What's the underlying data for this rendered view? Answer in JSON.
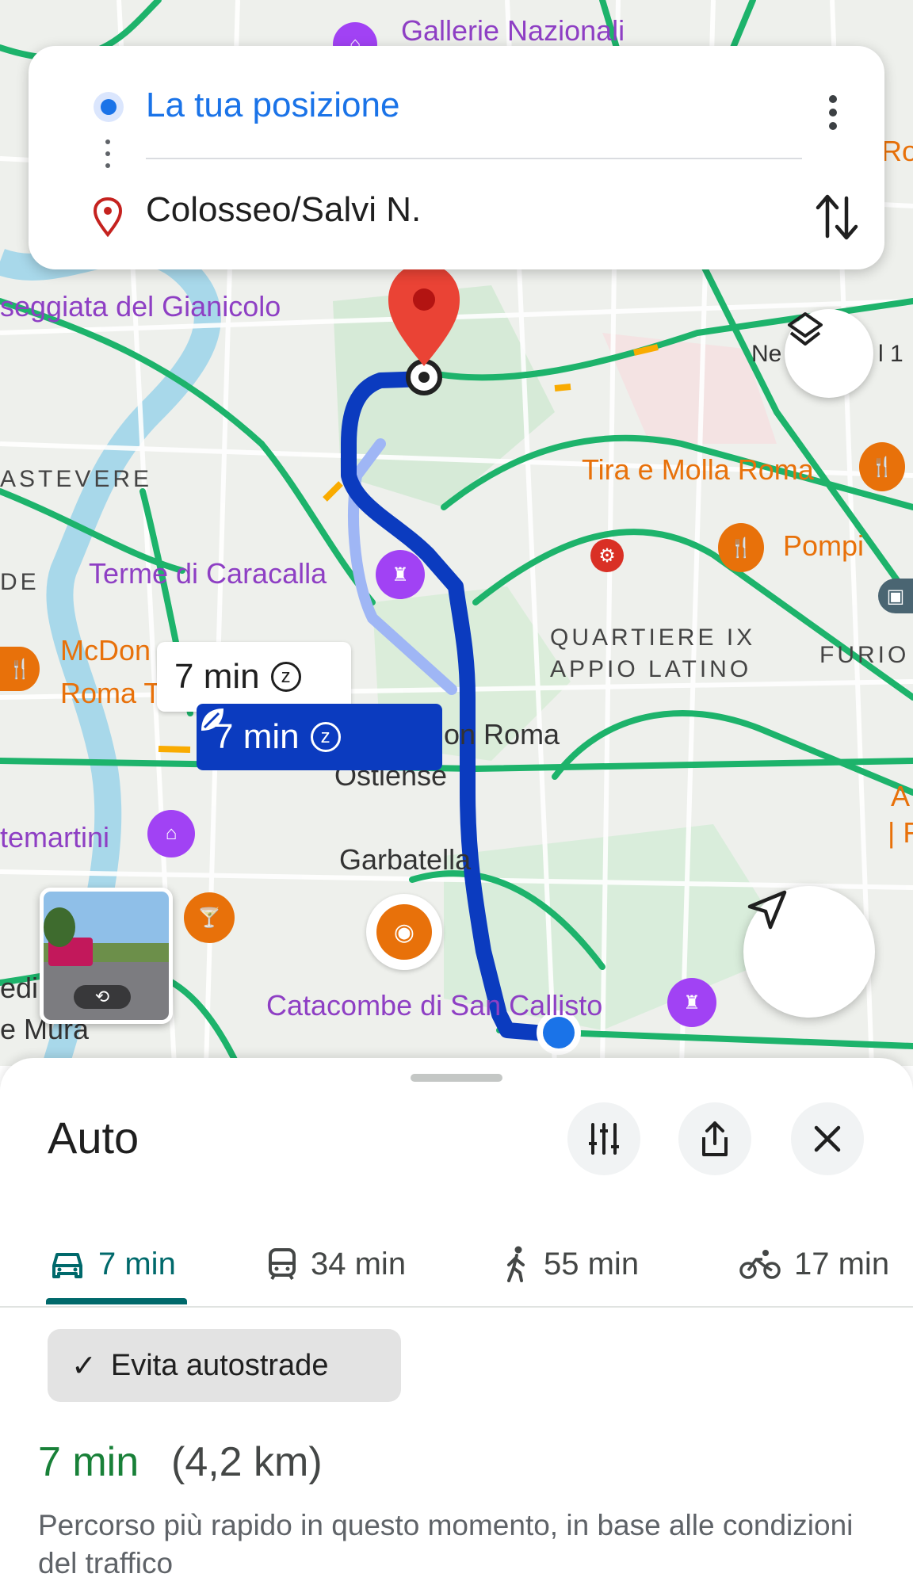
{
  "search": {
    "origin": "La tua posizione",
    "destination": "Colosseo/Salvi N."
  },
  "map": {
    "labels": {
      "gallerie": "Gallerie Nazionali",
      "passeggiata": "seggiata del Gianicolo",
      "trastevere": "ASTEVERE",
      "de": "DE",
      "caracalla": "Terme di Caracalla",
      "mcdon1": "McDon",
      "mcdon2": "Roma T",
      "tiramolla": "Tira e Molla Roma",
      "pompi": "Pompi",
      "quartiere1": "QUARTIERE IX",
      "quartiere2": "APPIO LATINO",
      "furio": "FURIO",
      "onroma": "on Roma",
      "ostiense": "Ostiense",
      "montemartini": "temartini",
      "garbatella": "Garbatella",
      "catacombe": "Catacombe di San Callisto",
      "mura": "e Mura",
      "edi": "edi",
      "ne": "Ne",
      "l1": "l 1",
      "ro": "Ro",
      "te": "Te",
      "a": "A",
      "f": "| F"
    },
    "route_main_time": "7 min",
    "route_alt_time": "7 min"
  },
  "sheet": {
    "title": "Auto",
    "modes": [
      {
        "label": "7 min",
        "icon": "car-icon",
        "active": true
      },
      {
        "label": "34 min",
        "icon": "transit-icon",
        "active": false
      },
      {
        "label": "55 min",
        "icon": "walk-icon",
        "active": false
      },
      {
        "label": "17 min",
        "icon": "bike-icon",
        "active": false
      }
    ],
    "chip": "Evita autostrade",
    "result_time": "7 min",
    "result_distance": "(4,2 km)",
    "result_description": "Percorso più rapido in questo momento, in base alle condizioni del traffico"
  },
  "colors": {
    "route": "#0b3bbf",
    "accent": "#1a73e8",
    "traffic_green": "#1db36b",
    "mode_active": "#00696b",
    "result_green": "#188038"
  }
}
